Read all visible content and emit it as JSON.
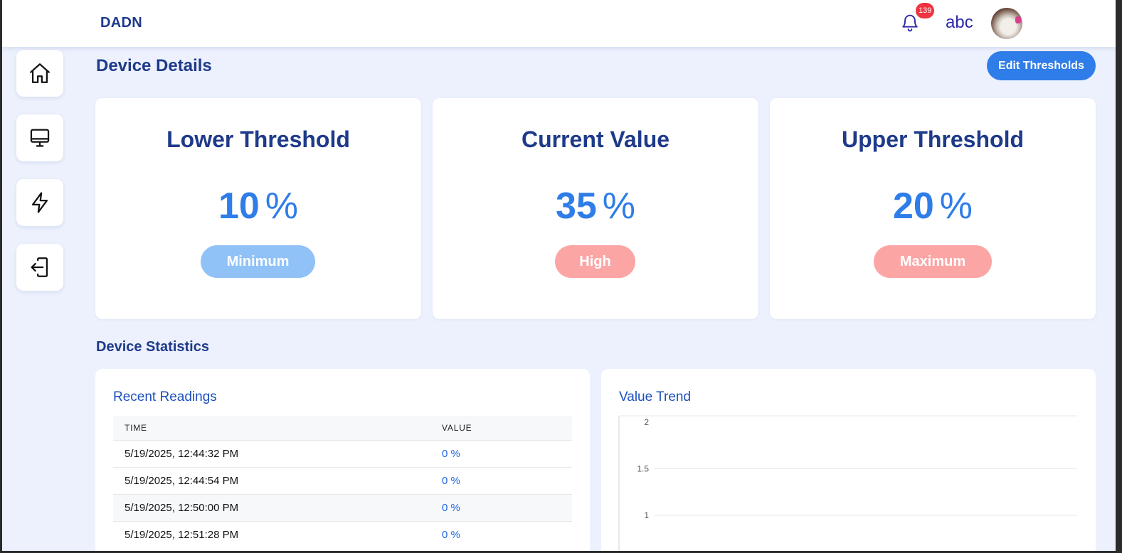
{
  "app": {
    "brand": "DADN"
  },
  "header": {
    "notification_count": "139",
    "username": "abc",
    "icons": {
      "bell": "bell-icon",
      "avatar": "avatar-image"
    }
  },
  "sidebar": {
    "items": [
      {
        "name": "home",
        "icon": "home-icon"
      },
      {
        "name": "devices",
        "icon": "monitor-icon"
      },
      {
        "name": "energy",
        "icon": "lightning-icon"
      },
      {
        "name": "logout",
        "icon": "logout-icon"
      }
    ]
  },
  "page": {
    "title": "Device Details",
    "edit_button": "Edit Thresholds"
  },
  "cards": [
    {
      "title": "Lower Threshold",
      "value": "10",
      "unit": "%",
      "tag": "Minimum",
      "tag_color": "#90c2f7"
    },
    {
      "title": "Current Value",
      "value": "35",
      "unit": "%",
      "tag": "High",
      "tag_color": "#fca5a5"
    },
    {
      "title": "Upper Threshold",
      "value": "20",
      "unit": "%",
      "tag": "Maximum",
      "tag_color": "#fca5a5"
    }
  ],
  "statistics": {
    "title": "Device Statistics",
    "readings": {
      "title": "Recent Readings",
      "columns": [
        "TIME",
        "VALUE"
      ],
      "rows": [
        {
          "time": "5/19/2025, 12:44:32 PM",
          "value": "0 %"
        },
        {
          "time": "5/19/2025, 12:44:54 PM",
          "value": "0 %"
        },
        {
          "time": "5/19/2025, 12:50:00 PM",
          "value": "0 %"
        },
        {
          "time": "5/19/2025, 12:51:28 PM",
          "value": "0 %"
        }
      ]
    },
    "trend": {
      "title": "Value Trend"
    }
  },
  "colors": {
    "accent": "#2f7de8",
    "navy": "#1e3a8a",
    "badge": "#ef3340",
    "background": "#ecf1fd"
  },
  "chart_data": {
    "type": "line",
    "title": "Value Trend",
    "yticks": [
      "2",
      "1.5",
      "1"
    ],
    "ylim": [
      1,
      2
    ],
    "grid": true
  }
}
